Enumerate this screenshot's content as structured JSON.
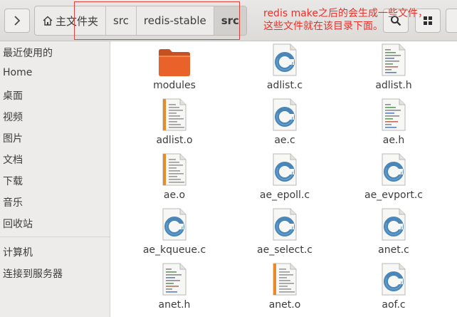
{
  "toolbar": {
    "back_icon": "chevron-right-icon",
    "breadcrumbs": [
      {
        "label": "主文件夹",
        "icon": "home-icon"
      },
      {
        "label": "src"
      },
      {
        "label": "redis-stable"
      },
      {
        "label": "src",
        "active": true
      }
    ],
    "search_icon": "search-icon",
    "view_icon": "grid-view-icon"
  },
  "annotation": {
    "line1": "redis  make之后的会生成一些文件，",
    "line2": "这些文件就在该目录下面。",
    "color": "#e8302a"
  },
  "sidebar": {
    "items": [
      {
        "label": "最近使用的"
      },
      {
        "label": "Home"
      },
      {
        "label": "桌面"
      },
      {
        "label": "视频"
      },
      {
        "label": "图片"
      },
      {
        "label": "文档"
      },
      {
        "label": "下载"
      },
      {
        "label": "音乐"
      },
      {
        "label": "回收站"
      },
      {
        "label": "计算机"
      },
      {
        "label": "连接到服务器"
      }
    ]
  },
  "files": [
    {
      "name": "modules",
      "type": "folder"
    },
    {
      "name": "adlist.c",
      "type": "c-source"
    },
    {
      "name": "adlist.h",
      "type": "c-header"
    },
    {
      "name": "adlist.o",
      "type": "object"
    },
    {
      "name": "ae.c",
      "type": "c-source"
    },
    {
      "name": "ae.h",
      "type": "c-header"
    },
    {
      "name": "ae.o",
      "type": "object"
    },
    {
      "name": "ae_epoll.c",
      "type": "c-source"
    },
    {
      "name": "ae_evport.c",
      "type": "c-source"
    },
    {
      "name": "ae_kqueue.c",
      "type": "c-source"
    },
    {
      "name": "ae_select.c",
      "type": "c-source"
    },
    {
      "name": "anet.c",
      "type": "c-source"
    },
    {
      "name": "anet.h",
      "type": "c-header"
    },
    {
      "name": "anet.o",
      "type": "object"
    },
    {
      "name": "aof.c",
      "type": "c-source"
    }
  ],
  "colors": {
    "folder": "#e8622a",
    "c_source": "#4a86b8",
    "object_stripe": "#e98a2a",
    "annotation": "#e8302a"
  }
}
